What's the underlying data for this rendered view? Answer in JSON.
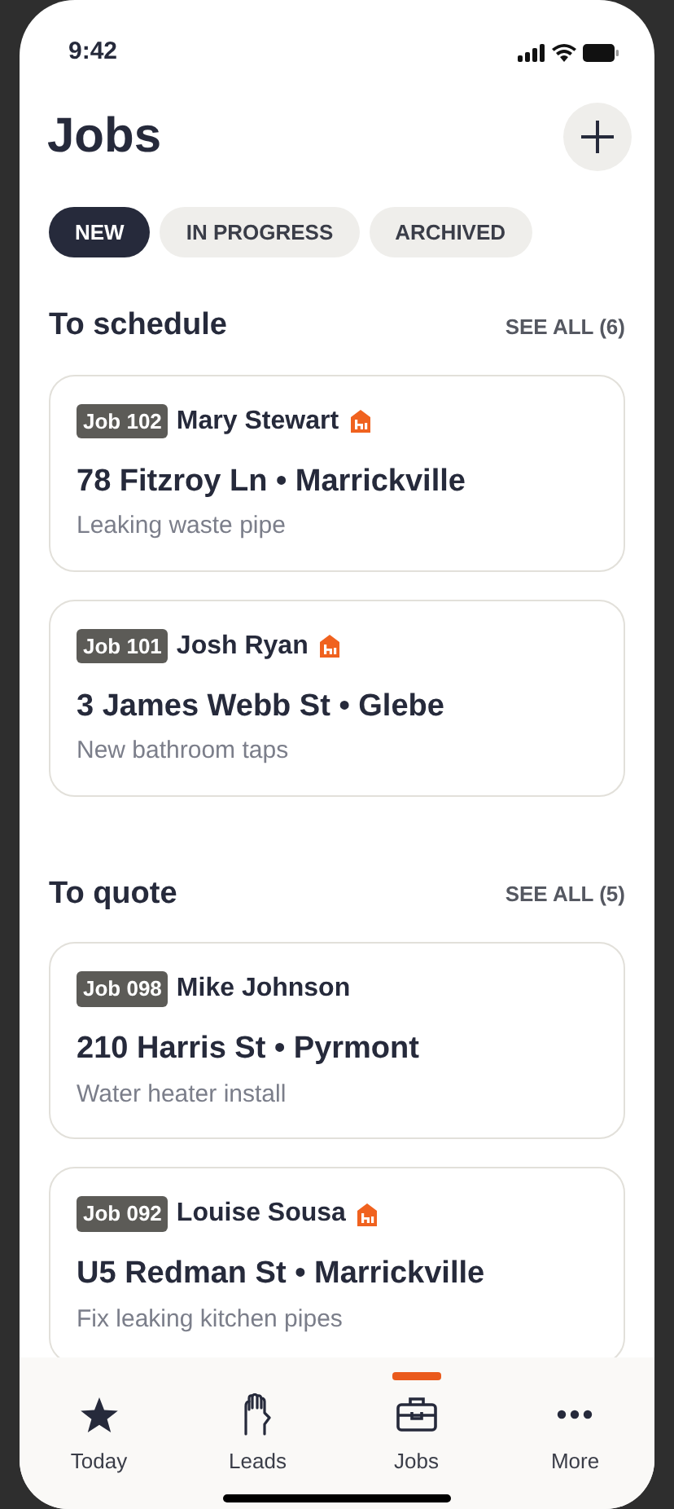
{
  "status_bar": {
    "time": "9:42"
  },
  "header": {
    "title": "Jobs"
  },
  "tabs": [
    {
      "label": "NEW",
      "selected": true
    },
    {
      "label": "IN PROGRESS",
      "selected": false
    },
    {
      "label": "ARCHIVED",
      "selected": false
    }
  ],
  "sections": [
    {
      "title": "To schedule",
      "see_all": "SEE ALL (6)",
      "jobs": [
        {
          "number": "Job 102",
          "customer": "Mary Stewart",
          "badge": true,
          "address": "78 Fitzroy Ln • Marrickville",
          "description": "Leaking waste pipe"
        },
        {
          "number": "Job 101",
          "customer": "Josh Ryan",
          "badge": true,
          "address": "3 James Webb St • Glebe",
          "description": "New bathroom taps"
        }
      ]
    },
    {
      "title": "To quote",
      "see_all": "SEE ALL (5)",
      "jobs": [
        {
          "number": "Job 098",
          "customer": "Mike Johnson",
          "badge": false,
          "address": "210 Harris St • Pyrmont",
          "description": "Water heater install"
        },
        {
          "number": "Job 092",
          "customer": "Louise Sousa",
          "badge": true,
          "address": "U5 Redman St • Marrickville",
          "description": "Fix leaking kitchen pipes"
        }
      ]
    }
  ],
  "nav": [
    {
      "kind": "star",
      "label": "Today",
      "selected": false
    },
    {
      "kind": "hand",
      "label": "Leads",
      "selected": false
    },
    {
      "kind": "toolbox",
      "label": "Jobs",
      "selected": true
    },
    {
      "kind": "more",
      "label": "More",
      "selected": false
    }
  ]
}
